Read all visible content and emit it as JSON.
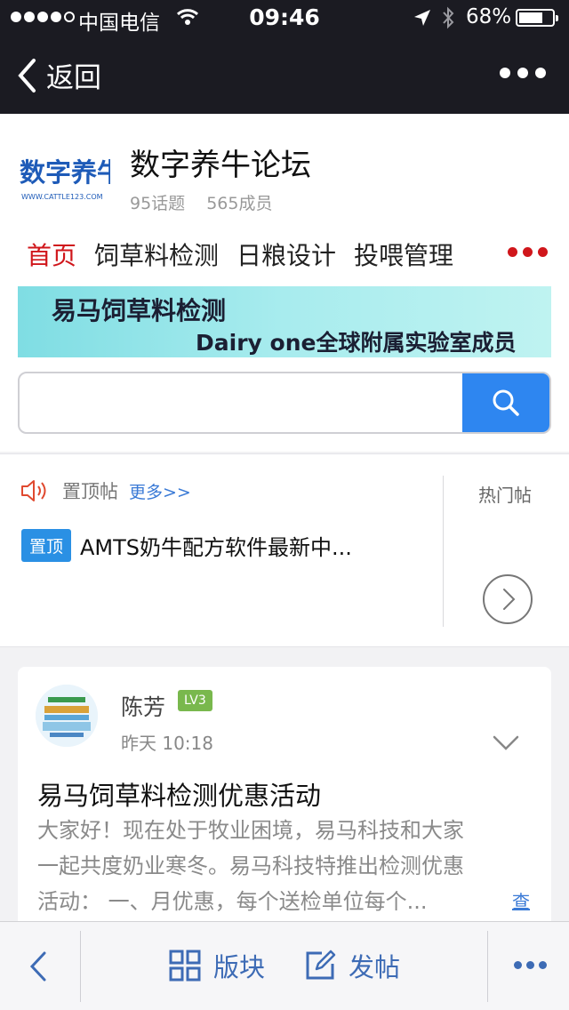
{
  "status_bar": {
    "carrier": "中国电信",
    "time": "09:46",
    "battery": "68%",
    "battery_level": 0.68
  },
  "nav": {
    "back_label": "返回"
  },
  "forum": {
    "logo_text": "数字养牛",
    "logo_url_text": "WWW.CATTLE123.COM",
    "name": "数字养牛论坛",
    "topics": "95话题",
    "members": "565成员"
  },
  "tabs": [
    {
      "label": "首页",
      "active": true
    },
    {
      "label": "饲草料检测",
      "active": false
    },
    {
      "label": "日粮设计",
      "active": false
    },
    {
      "label": "投喂管理",
      "active": false
    }
  ],
  "banner": {
    "line1": "易马饲草料检测",
    "line2": "Dairy one全球附属实验室成员"
  },
  "search": {
    "value": "",
    "placeholder": ""
  },
  "pinned": {
    "title": "置顶帖",
    "more": "更多>>",
    "tag": "置顶",
    "post_title": "AMTS奶牛配方软件最新中...",
    "hot_label": "热门帖"
  },
  "post": {
    "author": "陈芳",
    "level": "LV3",
    "time": "昨天 10:18",
    "title": "易马饲草料检测优惠活动",
    "body_lines": [
      "大家好！现在处于牧业困境，易马科技和大家",
      "一起共度奶业寒冬。易马科技特推出检测优惠",
      "活动： 一、月优惠，每个送检单位每个..."
    ],
    "view_more": "查"
  },
  "bottom_bar": {
    "sections_label": "版块",
    "post_label": "发帖"
  },
  "colors": {
    "accent": "#2e86f0",
    "active_tab": "#d0161b",
    "toolbar_text": "#3d6bb5",
    "level_badge": "#79b84d"
  }
}
